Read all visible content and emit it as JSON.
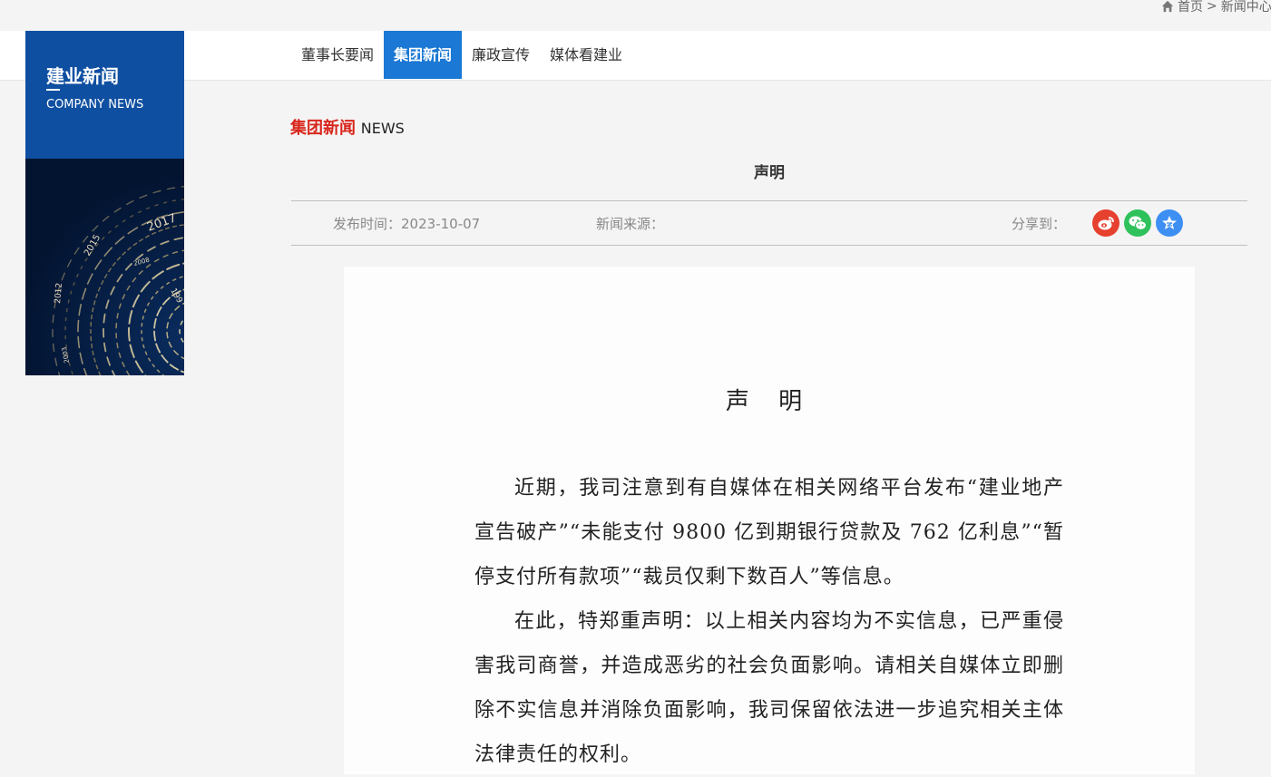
{
  "breadcrumb": {
    "home": "首页",
    "sep": ">",
    "current": "新闻中心"
  },
  "nav": {
    "tabs": [
      "董事长要闻",
      "集团新闻",
      "廉政宣传",
      "媒体看建业"
    ],
    "active_index": 1
  },
  "sidebar": {
    "title": "建业新闻",
    "subtitle_en": "COMPANY NEWS",
    "years": [
      "2017",
      "2015",
      "2012",
      "2008",
      "199",
      "2003"
    ]
  },
  "section": {
    "title_cn": "集团新闻",
    "title_en": "NEWS"
  },
  "article": {
    "title": "声明",
    "date_label": "发布时间：",
    "date": "2023-10-07",
    "source_label": "新闻来源：",
    "share_label": "分享到："
  },
  "statement": {
    "title": "声 明",
    "paragraphs": [
      "近期，我司注意到有自媒体在相关网络平台发布“建业地产宣告破产”“未能支付 9800 亿到期银行贷款及 762 亿利息”“暂停支付所有款项”“裁员仅剩下数百人”等信息。",
      "在此，特郑重声明：以上相关内容均为不实信息，已严重侵害我司商誉，并造成恶劣的社会负面影响。请相关自媒体立即删除不实信息并消除负面影响，我司保留依法进一步追究相关主体法律责任的权利。"
    ]
  },
  "colors": {
    "accent": "#1b78d4",
    "section_red": "#d9261c",
    "sidebar_blue": "#0f4fa1"
  },
  "icons": [
    "home-icon",
    "weibo-icon",
    "wechat-icon",
    "qzone-icon"
  ]
}
